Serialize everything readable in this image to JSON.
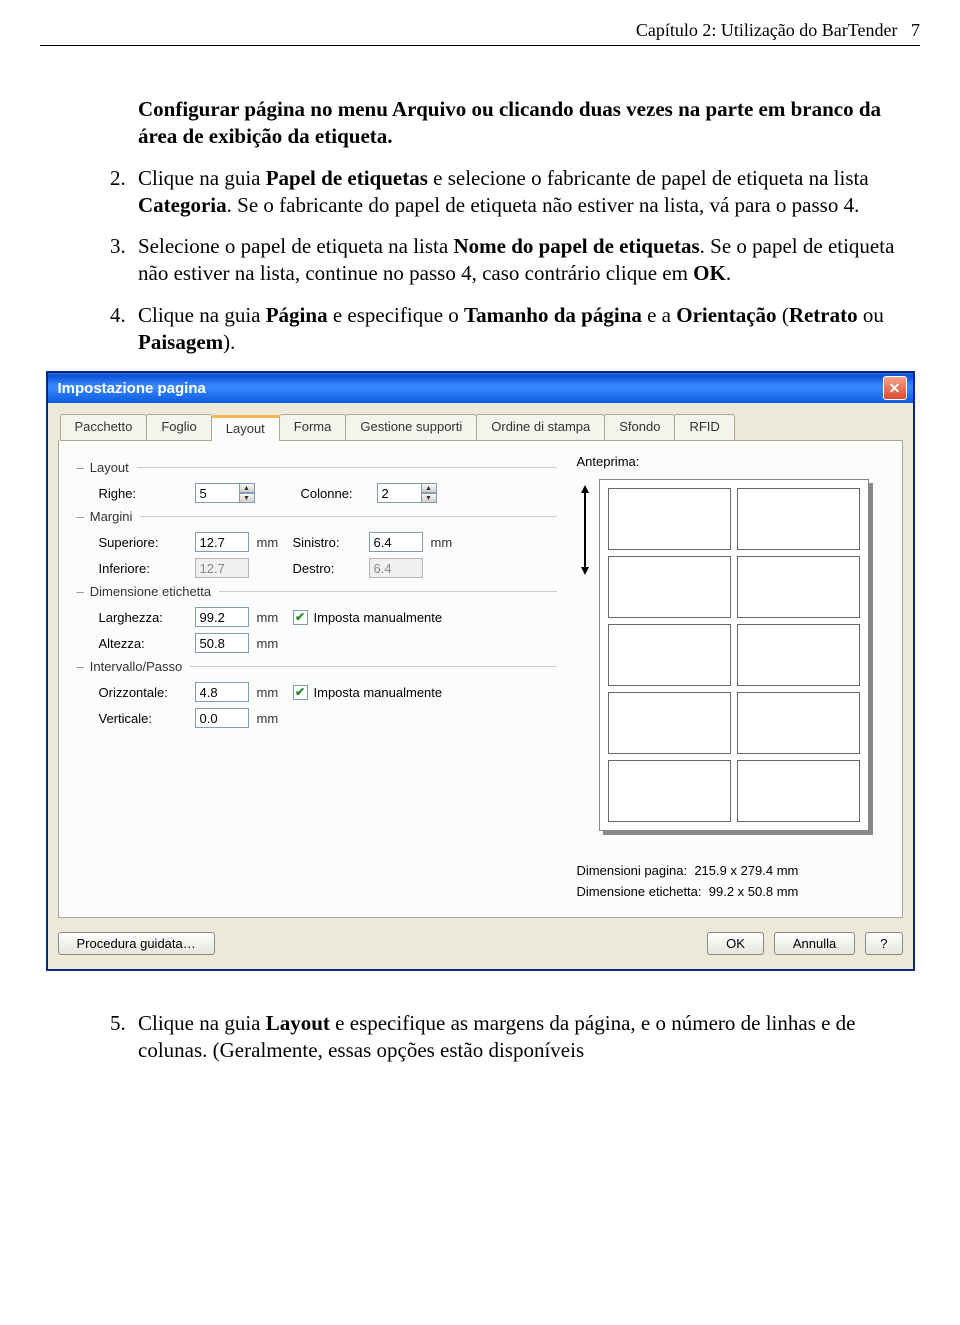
{
  "header": {
    "chapter": "Capítulo 2: Utilização do BarTender",
    "page": "7"
  },
  "doc": {
    "para1": "Configurar página no menu Arquivo ou clicando duas vezes na parte em branco da área de exibição da etiqueta.",
    "item2_a": "Clique na guia ",
    "item2_b": "Papel de etiquetas",
    "item2_c": " e selecione o fabricante de papel de etiqueta na lista ",
    "item2_d": "Categoria",
    "item2_e": ". Se o fabricante do papel de etiqueta não estiver na lista, vá para o passo 4.",
    "item3_a": "Selecione o papel de etiqueta na lista ",
    "item3_b": "Nome do papel de etiquetas",
    "item3_c": ". Se o papel de etiqueta não estiver na lista, continue no passo 4, caso contrário clique em ",
    "item3_d": "OK",
    "item3_e": ".",
    "item4_a": "Clique na guia ",
    "item4_b": "Página",
    "item4_c": " e especifique o ",
    "item4_d": "Tamanho da página",
    "item4_e": " e a ",
    "item4_f": "Orientação",
    "item4_g": " (",
    "item4_h": "Retrato",
    "item4_i": " ou ",
    "item4_j": "Paisagem",
    "item4_k": ").",
    "item5_a": "Clique na guia ",
    "item5_b": "Layout",
    "item5_c": " e especifique as margens da página, e o número de linhas e de colunas. (Geralmente, essas opções estão disponíveis",
    "num2": "2.",
    "num3": "3.",
    "num4": "4.",
    "num5": "5."
  },
  "dialog": {
    "title": "Impostazione pagina",
    "tabs": [
      "Pacchetto",
      "Foglio",
      "Layout",
      "Forma",
      "Gestione supporti",
      "Ordine di stampa",
      "Sfondo",
      "RFID"
    ],
    "active_tab": 2,
    "groups": {
      "layout": "Layout",
      "margini": "Margini",
      "dim_etichetta": "Dimensione etichetta",
      "intervallo": "Intervallo/Passo"
    },
    "fields": {
      "righe_label": "Righe:",
      "righe_value": "5",
      "colonne_label": "Colonne:",
      "colonne_value": "2",
      "superiore_label": "Superiore:",
      "superiore_value": "12.7",
      "inferiore_label": "Inferiore:",
      "inferiore_value": "12.7",
      "sinistro_label": "Sinistro:",
      "sinistro_value": "6.4",
      "destro_label": "Destro:",
      "destro_value": "6.4",
      "larghezza_label": "Larghezza:",
      "larghezza_value": "99.2",
      "altezza_label": "Altezza:",
      "altezza_value": "50.8",
      "orizzontale_label": "Orizzontale:",
      "orizzontale_value": "4.8",
      "verticale_label": "Verticale:",
      "verticale_value": "0.0",
      "unit": "mm",
      "imposta_man": "Imposta manualmente"
    },
    "preview": {
      "label": "Anteprima:",
      "dim_pagina_label": "Dimensioni pagina:",
      "dim_pagina_value": "215.9 x 279.4  mm",
      "dim_etichetta_label": "Dimensione etichetta:",
      "dim_etichetta_value": "99.2 x 50.8  mm"
    },
    "buttons": {
      "wizard": "Procedura guidata…",
      "ok": "OK",
      "cancel": "Annulla",
      "help": "?"
    }
  }
}
